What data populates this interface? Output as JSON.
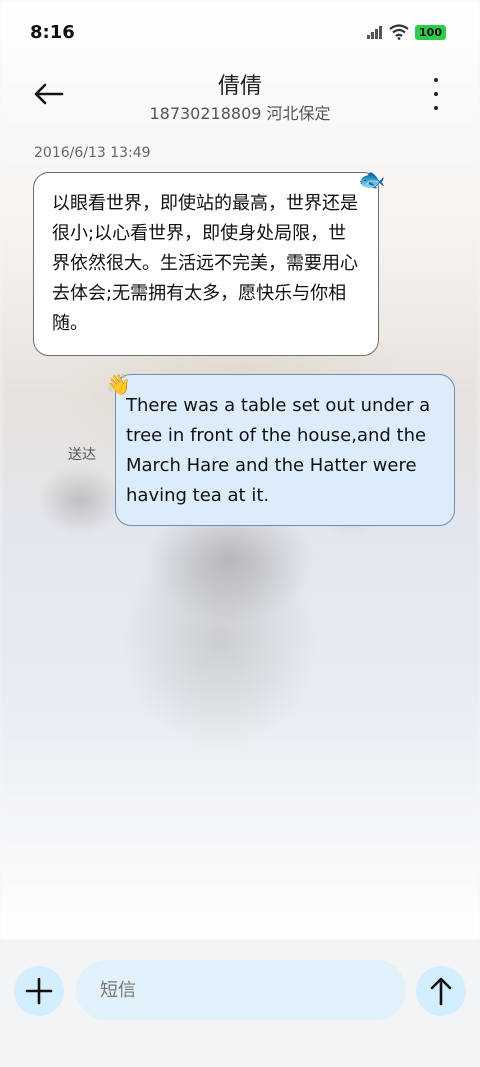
{
  "status_bar": {
    "time": "8:16",
    "battery": "100",
    "battery_color": "#2dcc4a"
  },
  "header": {
    "contact_name": "倩倩",
    "contact_detail": "18730218809 河北保定"
  },
  "conversation": {
    "timestamp": "2016/6/13 13:49",
    "incoming_message": "以眼看世界，即使站的最高，世界还是很小;以心看世界，即使身处局限，世界依然很大。生活远不完美，需要用心去体会;无需拥有太多，愿快乐与你相随。",
    "incoming_icon": "fish-icon",
    "outgoing_message": "There was a table set out under a tree in front of the house,and the March Hare and the Hatter were having tea at it.",
    "outgoing_icon": "waving-hand-icon",
    "delivery_status": "送达"
  },
  "composer": {
    "placeholder": "短信",
    "accent_color": "#d2eeff"
  }
}
